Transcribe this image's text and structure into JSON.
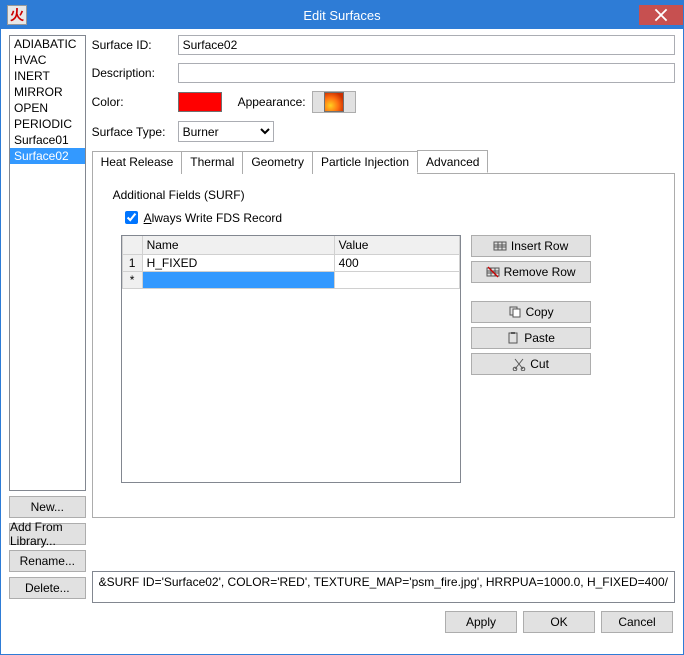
{
  "window": {
    "title": "Edit Surfaces"
  },
  "sidebar": {
    "items": [
      {
        "label": "ADIABATIC",
        "selected": false
      },
      {
        "label": "HVAC",
        "selected": false
      },
      {
        "label": "INERT",
        "selected": false
      },
      {
        "label": "MIRROR",
        "selected": false
      },
      {
        "label": "OPEN",
        "selected": false
      },
      {
        "label": "PERIODIC",
        "selected": false
      },
      {
        "label": "Surface01",
        "selected": false
      },
      {
        "label": "Surface02",
        "selected": true
      }
    ],
    "buttons": {
      "new": "New...",
      "add_from_library": "Add From Library...",
      "rename": "Rename...",
      "delete": "Delete..."
    }
  },
  "form": {
    "labels": {
      "surface_id": "Surface ID:",
      "description": "Description:",
      "color": "Color:",
      "appearance": "Appearance:",
      "surface_type": "Surface Type:"
    },
    "values": {
      "surface_id": "Surface02",
      "description": "",
      "color_hex": "#ff0000",
      "surface_type": "Burner"
    }
  },
  "tabs": [
    {
      "label": "Heat Release",
      "active": false
    },
    {
      "label": "Thermal",
      "active": false
    },
    {
      "label": "Geometry",
      "active": false
    },
    {
      "label": "Particle Injection",
      "active": false
    },
    {
      "label": "Advanced",
      "active": true
    }
  ],
  "advanced": {
    "section_title": "Additional Fields (SURF)",
    "checkbox": {
      "label_prefix": "A",
      "label_rest": "lways Write FDS Record",
      "checked": true
    },
    "grid": {
      "columns": [
        "Name",
        "Value"
      ],
      "rows": [
        {
          "num": "1",
          "name": "H_FIXED",
          "value": "400"
        },
        {
          "num": "*",
          "name": "",
          "value": ""
        }
      ]
    },
    "buttons": {
      "insert_row": "Insert Row",
      "remove_row": "Remove Row",
      "copy": "Copy",
      "paste": "Paste",
      "cut": "Cut"
    }
  },
  "output_line": "&SURF ID='Surface02', COLOR='RED', TEXTURE_MAP='psm_fire.jpg', HRRPUA=1000.0, H_FIXED=400/",
  "footer": {
    "apply": "Apply",
    "ok": "OK",
    "cancel": "Cancel"
  }
}
